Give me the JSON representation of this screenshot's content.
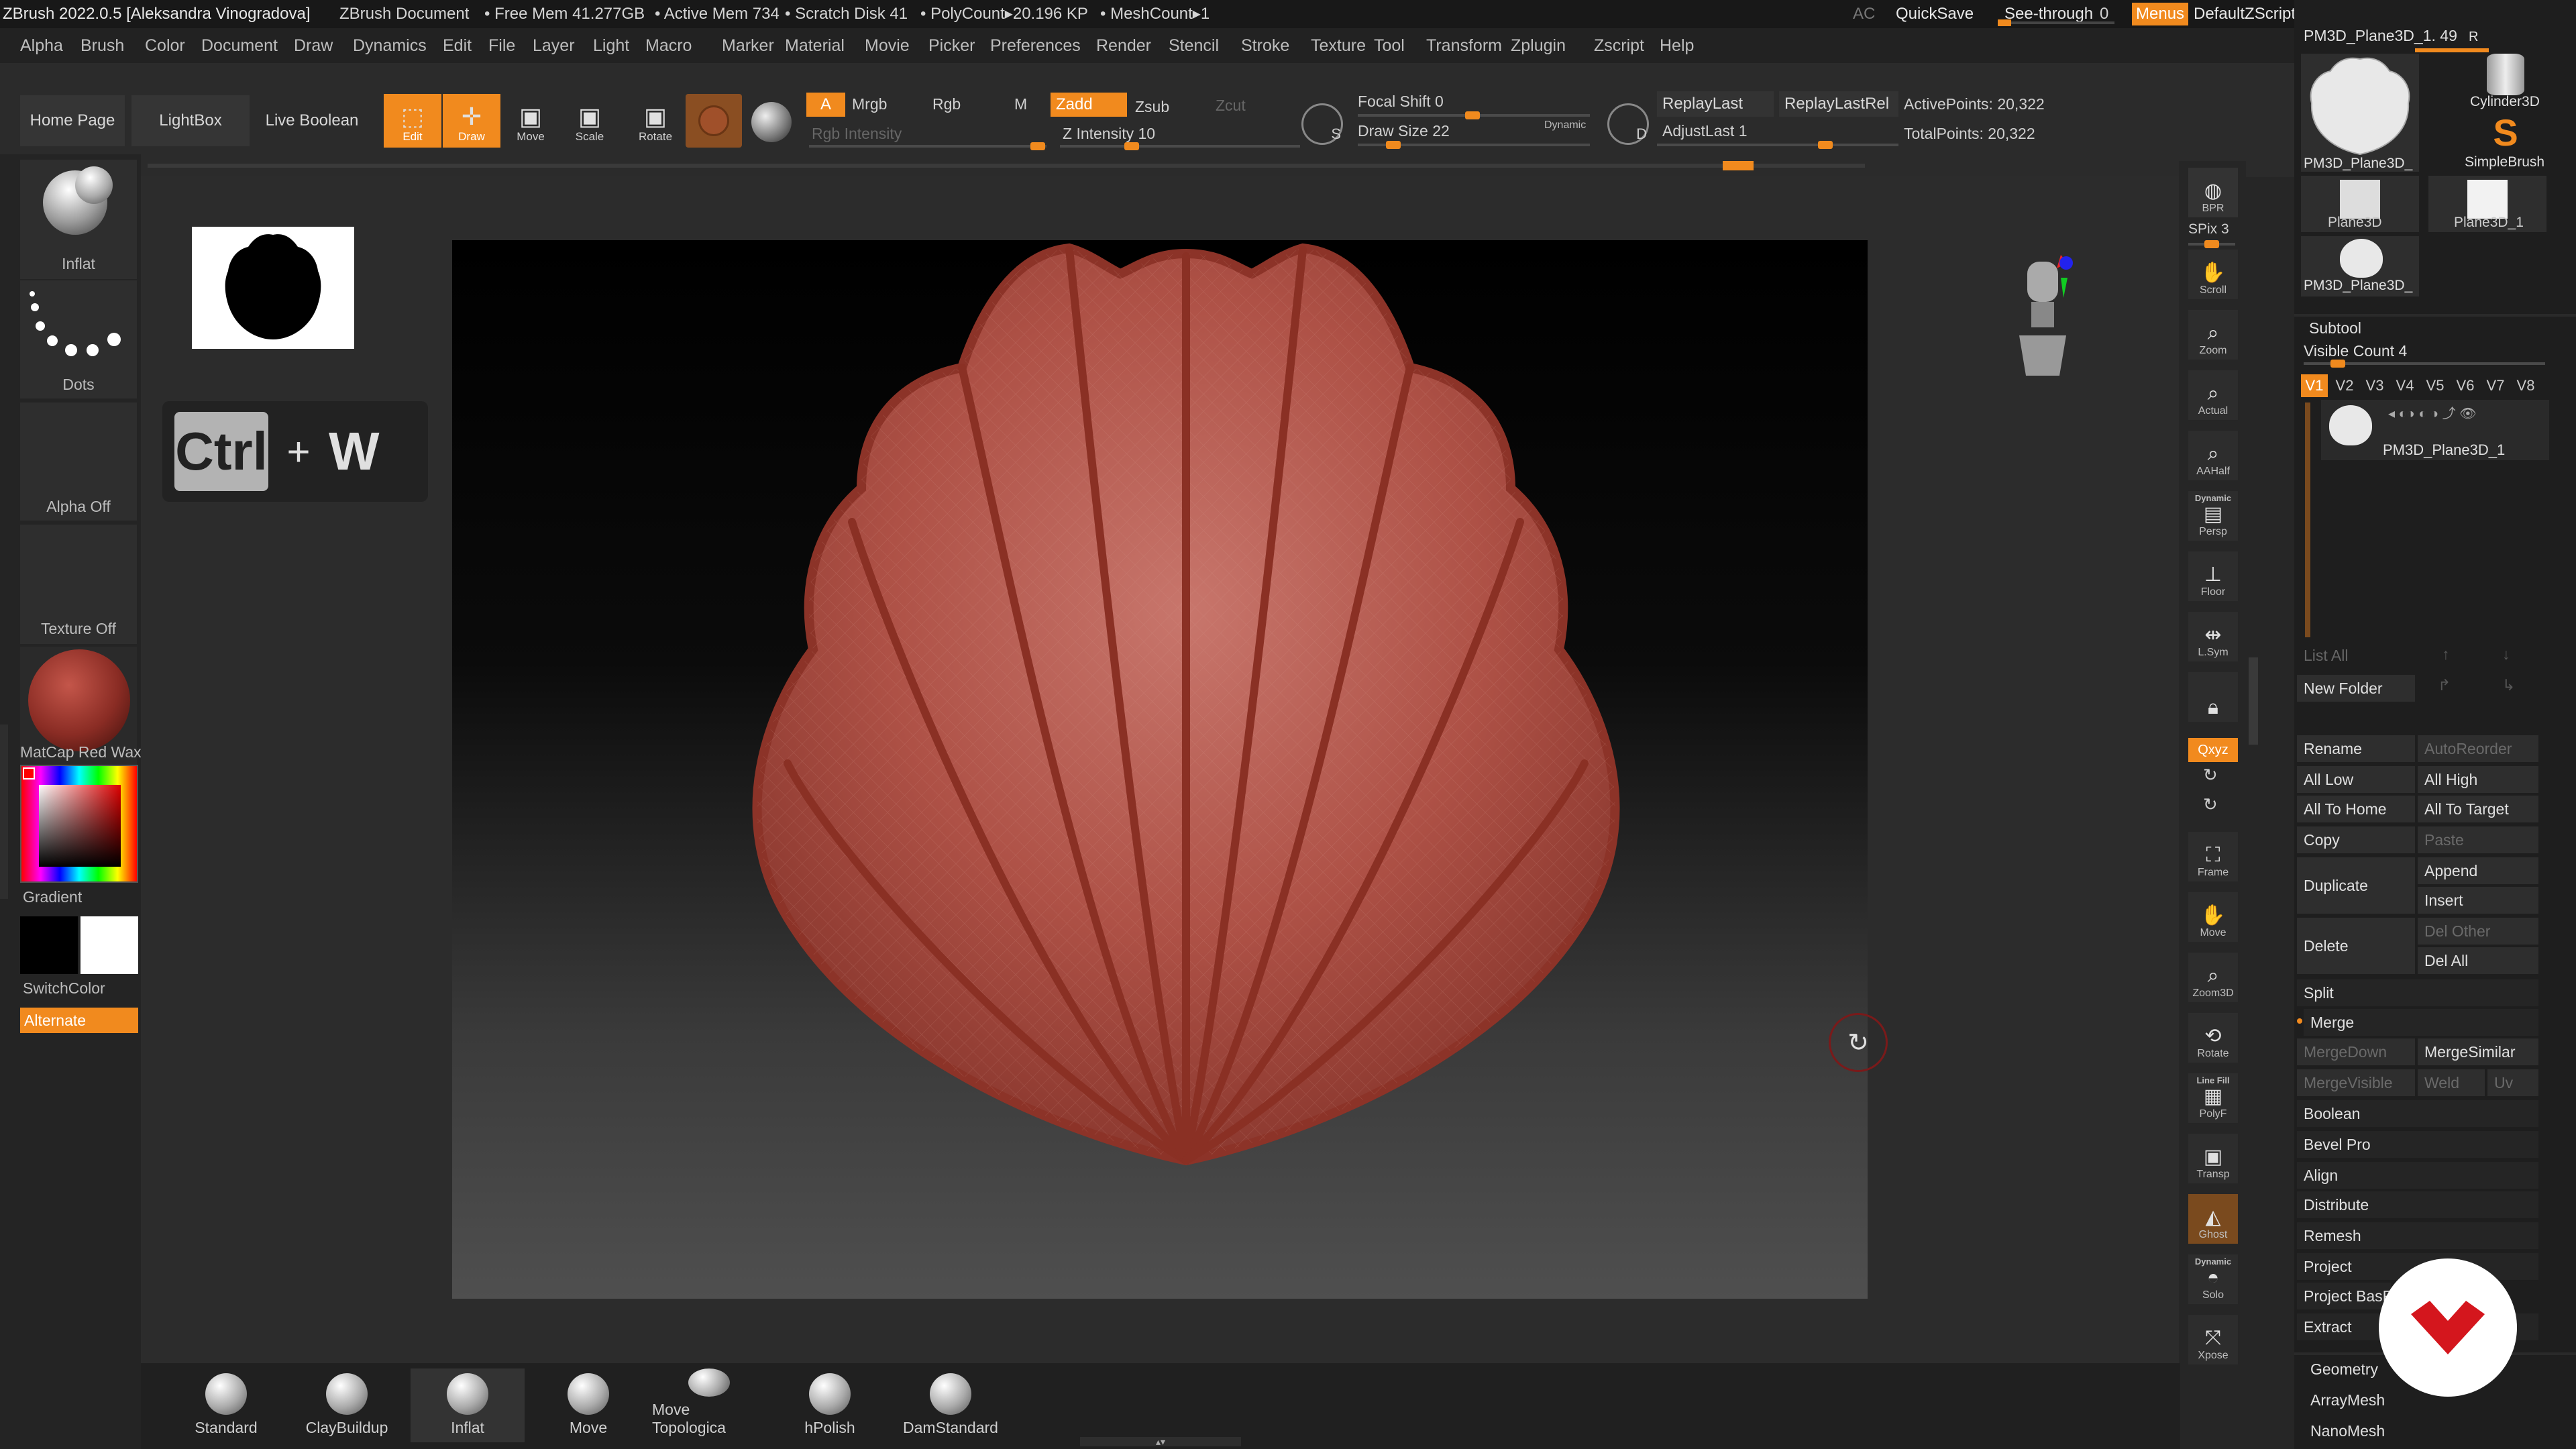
{
  "titlebar": {
    "app": "ZBrush 2022.0.5 [Aleksandra Vinogradova]",
    "document": "ZBrush Document",
    "free_mem": "• Free Mem 41.277GB",
    "active_mem": "• Active Mem 734",
    "scratch": "• Scratch Disk 41",
    "polycount": "• PolyCount▸20.196 KP",
    "meshcount": "• MeshCount▸1",
    "ac": "AC",
    "quicksave": "QuickSave",
    "seethrough": "See-through",
    "seethrough_val": "0",
    "menus": "Menus",
    "script": "DefaultZScript"
  },
  "menubar": [
    "Alpha",
    "Brush",
    "Color",
    "Document",
    "Draw",
    "Dynamics",
    "Edit",
    "File",
    "Layer",
    "Light",
    "Macro",
    "Marker",
    "Material",
    "Movie",
    "Picker",
    "Preferences",
    "Render",
    "Stencil",
    "Stroke",
    "Texture",
    "Tool",
    "Transform",
    "Zplugin",
    "Zscript",
    "Help"
  ],
  "shelf": {
    "home": "Home Page",
    "lightbox": "LightBox",
    "liveboolean": "Live Boolean",
    "edit": "Edit",
    "draw": "Draw",
    "move": "Move",
    "scale": "Scale",
    "rotate": "Rotate",
    "a": "A",
    "mrgb": "Mrgb",
    "rgb": "Rgb",
    "m": "M",
    "zadd": "Zadd",
    "zsub": "Zsub",
    "zcut": "Zcut",
    "rgb_intensity": "Rgb Intensity",
    "z_intensity": "Z Intensity 10",
    "focal_shift": "Focal Shift 0",
    "draw_size": "Draw Size 22",
    "dynamic": "Dynamic",
    "replaylast": "ReplayLast",
    "replaylastrel": "ReplayLastRel",
    "adjustlast": "AdjustLast 1",
    "activepoints": "ActivePoints: 20,322",
    "totalpoints": "TotalPoints: 20,322",
    "s_label": "S",
    "d_label": "D"
  },
  "leftcol": {
    "brush": "Inflat",
    "stroke": "Dots",
    "alpha": "Alpha Off",
    "texture": "Texture Off",
    "material": "MatCap Red Wax",
    "gradient": "Gradient",
    "switchcolor": "SwitchColor",
    "alternate": "Alternate"
  },
  "overlay": {
    "ctrl": "Ctrl",
    "plus": "+",
    "w": "W"
  },
  "righttool": {
    "bpr": "BPR",
    "spix": "SPix 3",
    "scroll": "Scroll",
    "zoom": "Zoom",
    "actual": "Actual",
    "aahalf": "AAHalf",
    "dynamic": "Dynamic",
    "persp": "Persp",
    "floor": "Floor",
    "lsym": "L.Sym",
    "xyz": "Qxyz",
    "frame": "Frame",
    "move": "Move",
    "zoom3d": "Zoom3D",
    "rotate": "Rotate",
    "linefill": "Line Fill",
    "polyf": "PolyF",
    "transp": "Transp",
    "ghost": "Ghost",
    "dynamic2": "Dynamic",
    "solo": "Solo",
    "xpose": "Xpose"
  },
  "rpanel": {
    "tool_title": "PM3D_Plane3D_1. 49",
    "r": "R",
    "tools": [
      "PM3D_Plane3D_",
      "Cylinder3D",
      "SimpleBrush",
      "Plane3D",
      "Plane3D_1",
      "PM3D_Plane3D_"
    ],
    "subtool": "Subtool",
    "visible_count": "Visible Count 4",
    "versions": [
      "V1",
      "V2",
      "V3",
      "V4",
      "V5",
      "V6",
      "V7",
      "V8"
    ],
    "subtool_item": "PM3D_Plane3D_1",
    "list_all": "List All",
    "new_folder": "New Folder",
    "rename": "Rename",
    "autoreorder": "AutoReorder",
    "all_low": "All Low",
    "all_high": "All High",
    "all_to_home": "All To Home",
    "all_to_target": "All To Target",
    "copy": "Copy",
    "paste": "Paste",
    "duplicate": "Duplicate",
    "append": "Append",
    "insert": "Insert",
    "delete": "Delete",
    "del_other": "Del Other",
    "del_all": "Del All",
    "split": "Split",
    "merge": "Merge",
    "mergedown": "MergeDown",
    "mergesimilar": "MergeSimilar",
    "mergevisible": "MergeVisible",
    "weld": "Weld",
    "uv": "Uv",
    "boolean": "Boolean",
    "bevelpro": "Bevel Pro",
    "align": "Align",
    "distribute": "Distribute",
    "remesh": "Remesh",
    "project": "Project",
    "projectbas": "Project BasRelief",
    "extract": "Extract",
    "geometry": "Geometry",
    "arraymesh": "ArrayMesh",
    "nanomesh": "NanoMesh"
  },
  "bottom": [
    "Standard",
    "ClayBuildup",
    "Inflat",
    "Move",
    "Move Topologica",
    "hPolish",
    "DamStandard"
  ],
  "colors": {
    "accent": "#f18a1e",
    "shell": "#a8453a"
  }
}
